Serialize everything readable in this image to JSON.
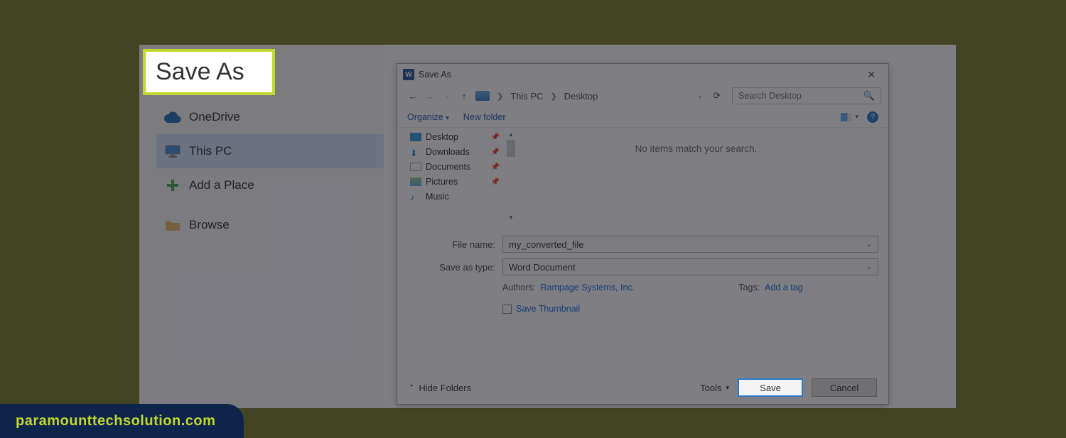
{
  "backstage": {
    "title": "Save As",
    "items": [
      {
        "label": "OneDrive",
        "selected": false
      },
      {
        "label": "This PC",
        "selected": true
      },
      {
        "label": "Add a Place",
        "selected": false
      },
      {
        "label": "Browse",
        "selected": false
      }
    ]
  },
  "dialog": {
    "title": "Save As",
    "breadcrumb": {
      "root": "This PC",
      "current": "Desktop"
    },
    "search_placeholder": "Search Desktop",
    "toolbar": {
      "organize": "Organize",
      "new_folder": "New folder"
    },
    "tree": [
      {
        "label": "Desktop",
        "icon": "desktop-icon",
        "pinned": true
      },
      {
        "label": "Downloads",
        "icon": "download-icon",
        "pinned": true
      },
      {
        "label": "Documents",
        "icon": "document-icon",
        "pinned": true
      },
      {
        "label": "Pictures",
        "icon": "picture-icon",
        "pinned": true
      },
      {
        "label": "Music",
        "icon": "music-icon",
        "pinned": false
      }
    ],
    "empty_message": "No items match your search.",
    "form": {
      "file_name_label": "File name:",
      "file_name_value": "my_converted_file",
      "save_type_label": "Save as type:",
      "save_type_value": "Word Document",
      "authors_label": "Authors:",
      "authors_value": "Rampage Systems, Inc.",
      "tags_label": "Tags:",
      "tags_value": "Add a tag",
      "thumbnail_label": "Save Thumbnail"
    },
    "footer": {
      "hide_folders": "Hide Folders",
      "tools": "Tools",
      "save": "Save",
      "cancel": "Cancel"
    }
  },
  "watermark": "paramounttechsolution.com"
}
